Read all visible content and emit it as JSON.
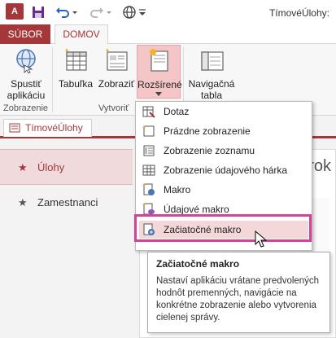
{
  "app": {
    "logo_text": "A",
    "document_title": "TímovéÚlohy:"
  },
  "tabs": {
    "file": "SÚBOR",
    "home": "DOMOV"
  },
  "ribbon": {
    "buttons": {
      "run_app": [
        "Spustiť",
        "aplikáciu"
      ],
      "table": "Tabuľka",
      "view": "Zobraziť",
      "advanced": "Rozšírené",
      "navigation": [
        "Navigačná",
        "tabla"
      ]
    },
    "groups": {
      "views": "Zobrazenie",
      "create": "Vytvoriť"
    }
  },
  "document_tab": "TímovéÚlohy",
  "nav": {
    "items": [
      {
        "label": "Úlohy"
      },
      {
        "label": "Zamestnanci"
      }
    ]
  },
  "content": {
    "title_fragment": "arok"
  },
  "dropdown": {
    "items": [
      {
        "label": "Dotaz",
        "icon": "query-icon"
      },
      {
        "label": "Prázdne zobrazenie",
        "icon": "blank-view-icon"
      },
      {
        "label": "Zobrazenie zoznamu",
        "icon": "list-view-icon"
      },
      {
        "label": "Zobrazenie údajového hárka",
        "icon": "datasheet-view-icon"
      },
      {
        "label": "Makro",
        "icon": "macro-icon"
      },
      {
        "label": "Údajové makro",
        "icon": "data-macro-icon"
      },
      {
        "label": "Začiatočné makro",
        "icon": "on-start-macro-icon"
      }
    ]
  },
  "tooltip": {
    "title": "Začiatočné makro",
    "body": "Nastaví aplikáciu vrátane predvolených hodnôt premenných, navigácie na konkrétne zobrazenie alebo vytvorenia cielenej správy."
  },
  "colors": {
    "accent": "#a4373a",
    "highlight_frame": "#d4429a",
    "selected_bg": "#f1dadb"
  }
}
